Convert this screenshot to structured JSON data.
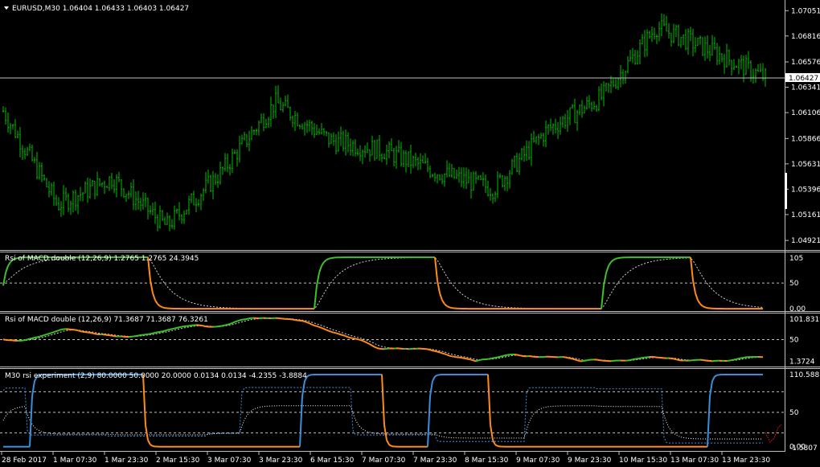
{
  "main": {
    "symbol_title": "EURUSD,M30  1.06404 1.06433 1.06403 1.06427",
    "current_price": "1.06427",
    "price_labels": [
      "1.07051",
      "1.06816",
      "1.06576",
      "1.06341",
      "1.06106",
      "1.05866",
      "1.05631",
      "1.05396",
      "1.05161",
      "1.04921"
    ],
    "price_range": [
      1.0487,
      1.0712
    ],
    "current_value": 1.06427,
    "candle_color": "#00c000",
    "line_color": "#c0c0c0"
  },
  "panel1": {
    "title": "Rsi of MACD double (12,26,9) 1.2765 1.2765 24.3945",
    "levels": [
      "105",
      "50",
      "0.00"
    ],
    "range": [
      -3,
      108
    ],
    "bull_color": "#3fc12a",
    "bear_color": "#ff8c1a",
    "signal_color": "#d0d0d0"
  },
  "panel2": {
    "title": "Rsi of MACD double (12,26,9) 71.3687 71.3687 76.3261",
    "levels": [
      "101.8319",
      "50",
      "1.3724"
    ],
    "range": [
      -8,
      106
    ],
    "bull_color": "#3fc12a",
    "bear_color": "#ff8c1a",
    "signal_color": "#d0d0d0"
  },
  "panel3": {
    "title": "M30 rsi experiment (2,9) 80.0000 50.0000 20.0000 0.0134 0.0134 -4.2355 -3.8884",
    "levels": [
      "110.588",
      "50",
      "0.00",
      "-1.5807"
    ],
    "range": [
      -5,
      112
    ],
    "up_color": "#3a8fdc",
    "down_color": "#ff8c1a",
    "dotted_color": "#3a8fdc"
  },
  "time_axis": [
    "28 Feb 2017",
    "1 Mar 07:30",
    "1 Mar 23:30",
    "2 Mar 15:30",
    "3 Mar 07:30",
    "3 Mar 23:30",
    "6 Mar 15:30",
    "7 Mar 07:30",
    "7 Mar 23:30",
    "8 Mar 15:30",
    "9 Mar 07:30",
    "9 Mar 23:30",
    "10 Mar 15:30",
    "13 Mar 07:30",
    "13 Mar 23:30"
  ],
  "chart_data": [
    {
      "type": "candlestick",
      "title": "EURUSD,M30  1.06404 1.06433 1.06403 1.06427",
      "ylim": [
        1.0487,
        1.0712
      ],
      "x": [
        "28 Feb 2017",
        "1 Mar 07:30",
        "1 Mar 23:30",
        "2 Mar 15:30",
        "3 Mar 07:30",
        "3 Mar 23:30",
        "6 Mar 15:30",
        "7 Mar 07:30",
        "7 Mar 23:30",
        "8 Mar 15:30",
        "9 Mar 07:30",
        "9 Mar 23:30",
        "10 Mar 15:30",
        "13 Mar 07:30",
        "13 Mar 23:30"
      ],
      "close_trend": [
        1.0612,
        1.0525,
        1.055,
        1.0505,
        1.0555,
        1.062,
        1.0585,
        1.0575,
        1.0555,
        1.054,
        1.0595,
        1.0625,
        1.069,
        1.0668,
        1.0643
      ]
    },
    {
      "type": "line",
      "title": "Rsi of MACD double (12,26,9) 1.2765 1.2765 24.3945",
      "ylim": [
        0,
        105
      ]
    },
    {
      "type": "line",
      "title": "Rsi of MACD double (12,26,9) 71.3687 71.3687 76.3261",
      "ylim": [
        1.3724,
        101.8319
      ]
    },
    {
      "type": "line",
      "title": "M30 rsi experiment (2,9) 80.0000 50.0000 20.0000 0.0134 0.0134 -4.2355 -3.8884",
      "ylim": [
        -1.5807,
        110.588
      ]
    }
  ]
}
